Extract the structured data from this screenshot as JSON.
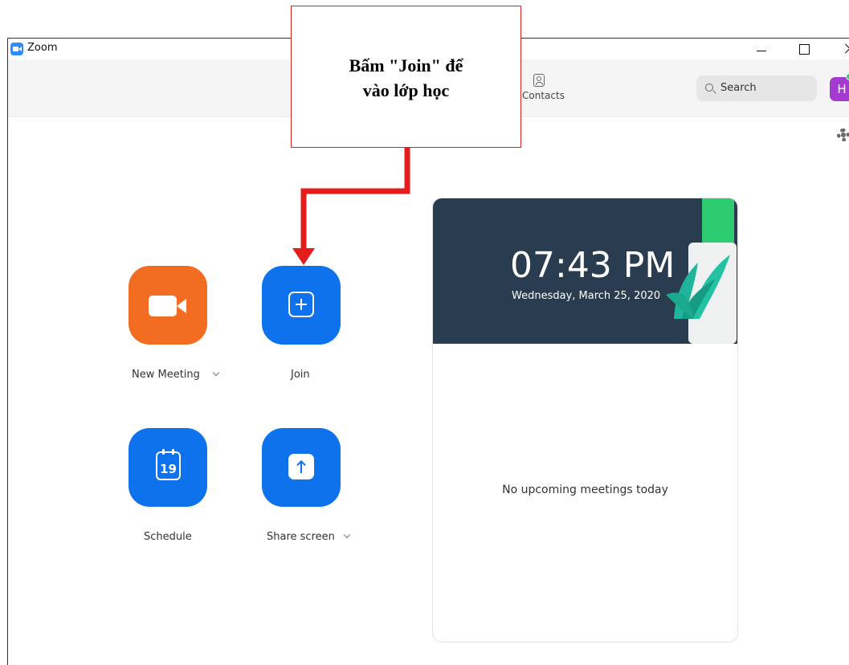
{
  "window": {
    "title": "Zoom"
  },
  "toolbar": {
    "contacts_label": "Contacts",
    "search_label": "Search",
    "avatar_initial": "H"
  },
  "actions": {
    "new_meeting": "New Meeting",
    "join": "Join",
    "schedule": "Schedule",
    "schedule_day": "19",
    "share_screen": "Share screen"
  },
  "meeting_card": {
    "time": "07:43 PM",
    "date": "Wednesday, March 25, 2020",
    "empty_message": "No upcoming meetings today"
  },
  "annotation": {
    "text": "Bấm \"Join\" để\nvào lớp học"
  },
  "colors": {
    "accent_blue": "#0e72ed",
    "new_meeting_orange": "#f26d21",
    "callout_red": "#e51c1c",
    "card_header": "#2a3c4f"
  },
  "icons": [
    "zoom-logo-icon",
    "contacts-icon",
    "search-icon",
    "gear-icon",
    "video-camera-icon",
    "plus-icon",
    "calendar-icon",
    "share-icon",
    "chevron-down-icon"
  ]
}
